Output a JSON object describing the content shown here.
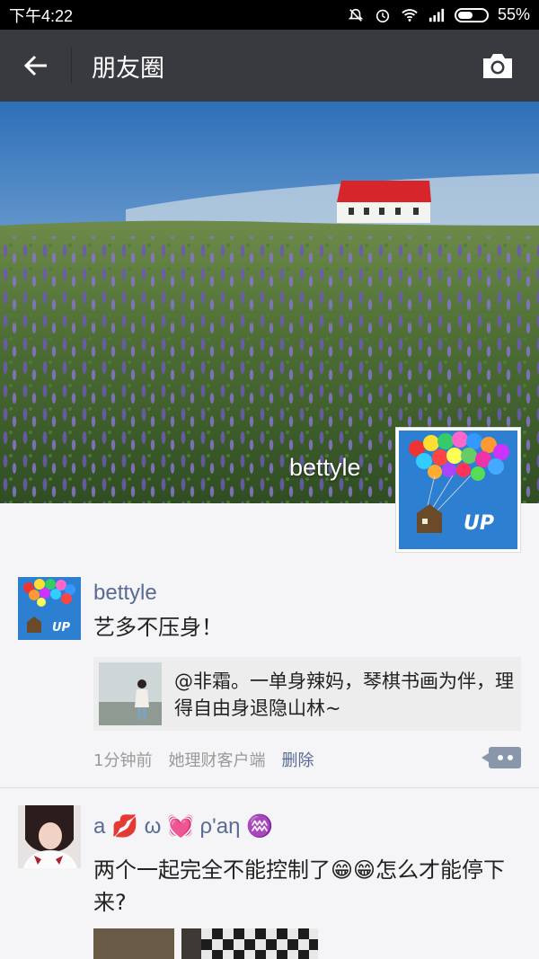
{
  "status_bar": {
    "time": "下午4:22",
    "battery_percent": "55%",
    "battery_level": 0.55,
    "icons": [
      "mute-icon",
      "alarm-icon",
      "wifi-icon",
      "signal-icon",
      "battery-icon"
    ]
  },
  "nav": {
    "back_icon": "arrow-left-icon",
    "title": "朋友圈",
    "camera_icon": "camera-icon"
  },
  "cover": {
    "user_name": "bettyle"
  },
  "posts": [
    {
      "author": "bettyle",
      "text": "艺多不压身！",
      "shared_link": {
        "text": "@非霜。一单身辣妈，琴棋书画为伴，理得自由身退隐山林~"
      },
      "time": "1分钟前",
      "source": "她理财客户端",
      "delete_label": "删除"
    },
    {
      "author": "a 💋 ω 💓 ρ'aη ♒",
      "text": "两个一起完全不能控制了😁😁怎么才能停下来?"
    }
  ],
  "colors": {
    "nav_bg": "#393a3f",
    "link_blue": "#576b95",
    "page_bg": "#f5f5f7"
  }
}
